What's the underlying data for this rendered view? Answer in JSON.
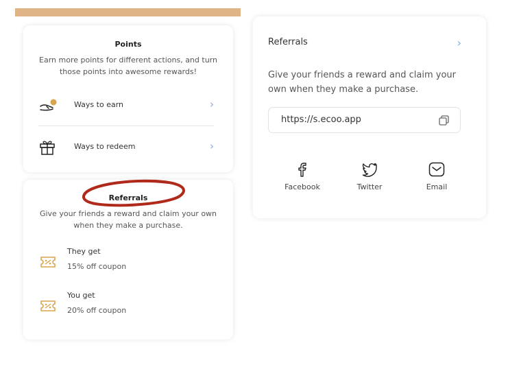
{
  "points": {
    "title": "Points",
    "description": "Earn more points for different actions, and turn those points into awesome rewards!",
    "items": [
      {
        "label": "Ways to earn",
        "icon": "hand-coin-icon"
      },
      {
        "label": "Ways to redeem",
        "icon": "gift-icon"
      }
    ]
  },
  "referrals": {
    "title": "Referrals",
    "description": "Give your friends a reward and claim your own when they make a purchase.",
    "items": [
      {
        "label": "They get",
        "value": "15% off coupon",
        "icon": "coupon-icon"
      },
      {
        "label": "You get",
        "value": "20% off coupon",
        "icon": "coupon-icon"
      }
    ]
  },
  "share": {
    "title": "Referrals",
    "description": "Give your friends a reward and claim your own when they make a purchase.",
    "link": "https://s.ecoo.app",
    "socials": [
      {
        "label": "Facebook",
        "icon": "facebook-icon"
      },
      {
        "label": "Twitter",
        "icon": "twitter-icon"
      },
      {
        "label": "Email",
        "icon": "email-icon"
      }
    ]
  },
  "colors": {
    "accent_bar": "#dfb587",
    "chevron": "#8aa7d8",
    "coupon": "#d9a44e",
    "highlight_oval": "#b02a1c"
  }
}
